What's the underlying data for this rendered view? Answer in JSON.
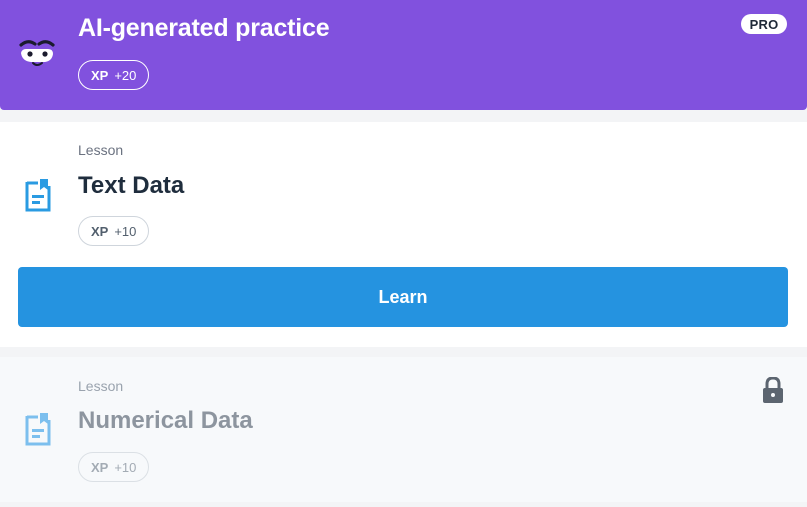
{
  "banner": {
    "title": "AI-generated practice",
    "badge": "PRO",
    "xp_label": "XP",
    "xp_value": "+20",
    "background": "#8151de"
  },
  "lessons": [
    {
      "kicker": "Lesson",
      "title": "Text Data",
      "xp_label": "XP",
      "xp_value": "+10",
      "button_label": "Learn",
      "icon": "document-icon",
      "locked": false
    },
    {
      "kicker": "Lesson",
      "title": "Numerical Data",
      "xp_label": "XP",
      "xp_value": "+10",
      "icon": "document-icon",
      "locked": true
    }
  ],
  "colors": {
    "accent_blue": "#2593e0",
    "icon_blue": "#2a9be2",
    "icon_blue_muted": "#7cbfee",
    "lock_gray": "#5c6570"
  }
}
